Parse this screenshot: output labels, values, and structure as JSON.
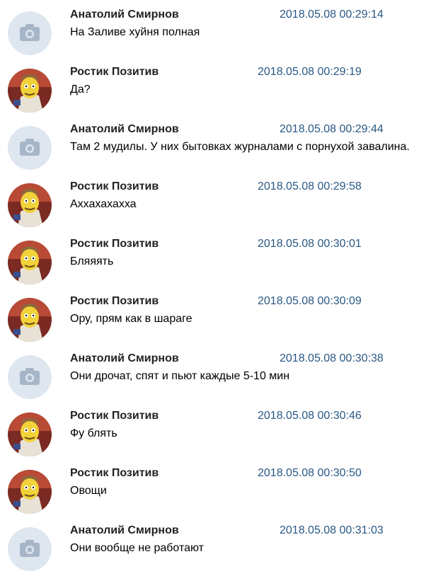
{
  "messages": [
    {
      "author": "Анатолий Смирнов",
      "time": "2018.05.08 00:29:14",
      "text": "На Заливе хуйня полная",
      "avatar": "camera-placeholder-icon"
    },
    {
      "author": "Ростик Позитив",
      "time": "2018.05.08 00:29:19",
      "text": "Да?",
      "avatar": "cartoon-character-avatar"
    },
    {
      "author": "Анатолий Смирнов",
      "time": "2018.05.08 00:29:44",
      "text": "Там 2 мудилы. У них бытовках журналами с порнухой завалина.",
      "avatar": "camera-placeholder-icon"
    },
    {
      "author": "Ростик Позитив",
      "time": "2018.05.08 00:29:58",
      "text": "Аххахахахха",
      "avatar": "cartoon-character-avatar"
    },
    {
      "author": "Ростик Позитив",
      "time": "2018.05.08 00:30:01",
      "text": "Бляяять",
      "avatar": "cartoon-character-avatar"
    },
    {
      "author": "Ростик Позитив",
      "time": "2018.05.08 00:30:09",
      "text": "Ору, прям как в шараге",
      "avatar": "cartoon-character-avatar"
    },
    {
      "author": "Анатолий Смирнов",
      "time": "2018.05.08 00:30:38",
      "text": "Они дрочат, спят и пьют каждые 5-10 мин",
      "avatar": "camera-placeholder-icon"
    },
    {
      "author": "Ростик Позитив",
      "time": "2018.05.08 00:30:46",
      "text": "Фу блять",
      "avatar": "cartoon-character-avatar"
    },
    {
      "author": "Ростик Позитив",
      "time": "2018.05.08 00:30:50",
      "text": "Овощи",
      "avatar": "cartoon-character-avatar"
    },
    {
      "author": "Анатолий Смирнов",
      "time": "2018.05.08 00:31:03",
      "text": "Они вообще не работают",
      "avatar": "camera-placeholder-icon"
    }
  ],
  "colors": {
    "author": "#222222",
    "time": "#2a5885",
    "text": "#000000",
    "placeholder_avatar_bg": "#dee6ef",
    "placeholder_icon": "#a6b6c8"
  }
}
